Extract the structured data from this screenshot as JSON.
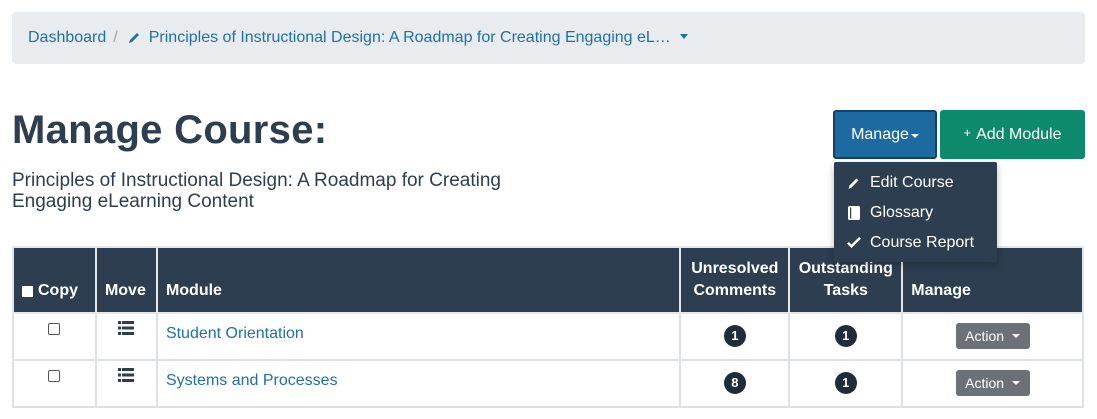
{
  "breadcrumb": {
    "dashboard": "Dashboard",
    "separator": "/",
    "course": "Principles of Instructional Design: A Roadmap for Creating Engaging eL…"
  },
  "page": {
    "title": "Manage Course:",
    "subtitle": "Principles of Instructional Design: A Roadmap for Creating Engaging eLearning Content"
  },
  "toolbar": {
    "manage_label": "Manage",
    "add_module_label": "Add Module",
    "add_module_icon": "+"
  },
  "manage_menu": {
    "items": [
      {
        "label": "Edit Course",
        "icon": "pencil-icon"
      },
      {
        "label": "Glossary",
        "icon": "book-icon"
      },
      {
        "label": "Course Report",
        "icon": "checkmark-icon"
      }
    ]
  },
  "table": {
    "headers": {
      "copy": "Copy",
      "move": "Move",
      "module": "Module",
      "unresolved_1": "Unresolved",
      "unresolved_2": "Comments",
      "outstanding_1": "Outstanding",
      "outstanding_2": "Tasks",
      "manage": "Manage"
    },
    "rows": [
      {
        "module": "Student Orientation",
        "unresolved": "1",
        "outstanding": "1",
        "action": "Action"
      },
      {
        "module": "Systems and Processes",
        "unresolved": "8",
        "outstanding": "1",
        "action": "Action"
      }
    ]
  },
  "colors": {
    "breadcrumb_bg": "#e9ecef",
    "link": "#1f6fa8",
    "manage_button": "#1d6aa1",
    "add_button": "#0d8a6b",
    "header_bg": "#2d3e50",
    "action_button": "#6c7177"
  }
}
